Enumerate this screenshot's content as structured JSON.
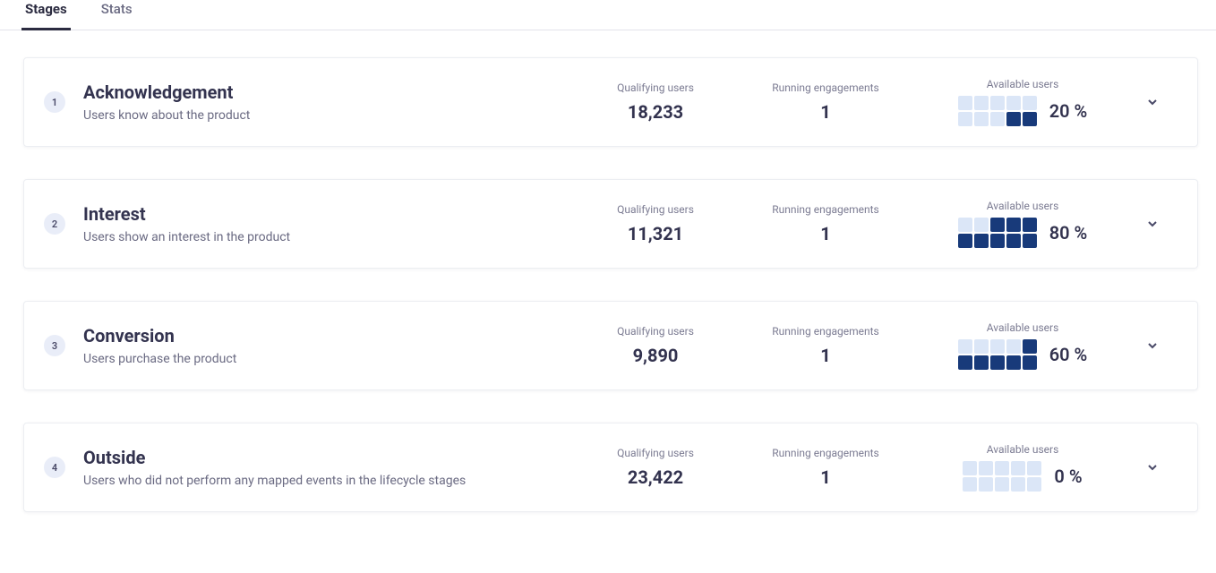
{
  "tabs": [
    {
      "label": "Stages",
      "active": true
    },
    {
      "label": "Stats",
      "active": false
    }
  ],
  "labels": {
    "qualifying": "Qualifying users",
    "running": "Running engagements",
    "available": "Available users"
  },
  "stages": [
    {
      "num": "1",
      "title": "Acknowledgement",
      "desc": "Users know about the product",
      "qualifying": "18,233",
      "running": "1",
      "availablePct": "20 %",
      "fill": 2
    },
    {
      "num": "2",
      "title": "Interest",
      "desc": "Users show an interest in the product",
      "qualifying": "11,321",
      "running": "1",
      "availablePct": "80 %",
      "fill": 8
    },
    {
      "num": "3",
      "title": "Conversion",
      "desc": "Users purchase the product",
      "qualifying": "9,890",
      "running": "1",
      "availablePct": "60 %",
      "fill": 6
    },
    {
      "num": "4",
      "title": "Outside",
      "desc": "Users who did not perform any mapped events in the lifecycle stages",
      "qualifying": "23,422",
      "running": "1",
      "availablePct": "0 %",
      "fill": 0
    }
  ]
}
